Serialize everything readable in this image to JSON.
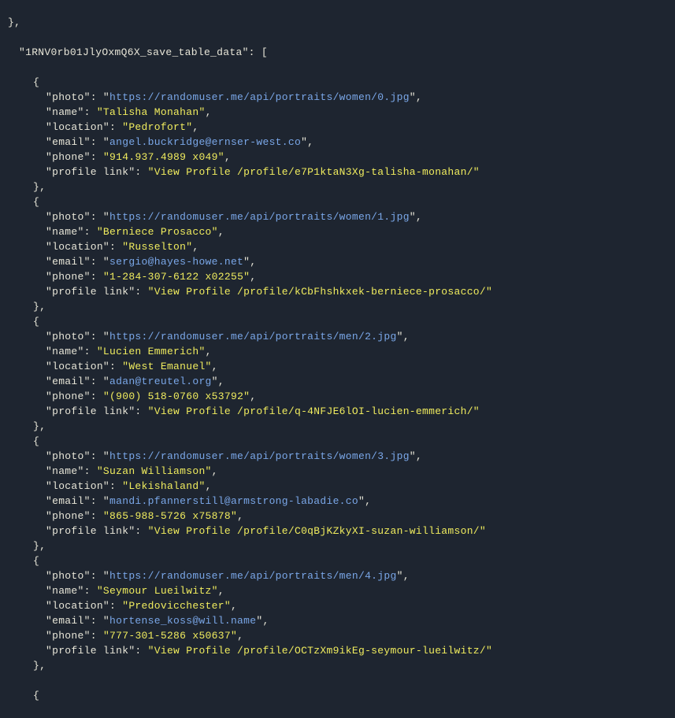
{
  "topKey": "1RNV0rb01JlyOxmQ6X_save_table_data",
  "fields": {
    "photo": "photo",
    "name": "name",
    "location": "location",
    "email": "email",
    "phone": "phone",
    "profileLink": "profile link"
  },
  "records": [
    {
      "photo": "https://randomuser.me/api/portraits/women/0.jpg",
      "name": "Talisha Monahan",
      "location": "Pedrofort",
      "email": "angel.buckridge@ernser-west.co",
      "phone": "914.937.4989 x049",
      "profileLink": "View Profile /profile/e7P1ktaN3Xg-talisha-monahan/"
    },
    {
      "photo": "https://randomuser.me/api/portraits/women/1.jpg",
      "name": "Berniece Prosacco",
      "location": "Russelton",
      "email": "sergio@hayes-howe.net",
      "phone": "1-284-307-6122 x02255",
      "profileLink": "View Profile /profile/kCbFhshkxek-berniece-prosacco/"
    },
    {
      "photo": "https://randomuser.me/api/portraits/men/2.jpg",
      "name": "Lucien Emmerich",
      "location": "West Emanuel",
      "email": "adan@treutel.org",
      "phone": "(900) 518-0760 x53792",
      "profileLink": "View Profile /profile/q-4NFJE6lOI-lucien-emmerich/"
    },
    {
      "photo": "https://randomuser.me/api/portraits/women/3.jpg",
      "name": "Suzan Williamson",
      "location": "Lekishaland",
      "email": "mandi.pfannerstill@armstrong-labadie.co",
      "phone": "865-988-5726 x75878",
      "profileLink": "View Profile /profile/C0qBjKZkyXI-suzan-williamson/"
    },
    {
      "photo": "https://randomuser.me/api/portraits/men/4.jpg",
      "name": "Seymour Lueilwitz",
      "location": "Predovicchester",
      "email": "hortense_koss@will.name",
      "phone": "777-301-5286 x50637",
      "profileLink": "View Profile /profile/OCTzXm9ikEg-seymour-lueilwitz/"
    }
  ],
  "closeBraceComma": "},",
  "openBrace": "{",
  "closeBrace": "}",
  "quote": "\"",
  "colon": ": ",
  "arrayOpen": ": [",
  "comma": ","
}
